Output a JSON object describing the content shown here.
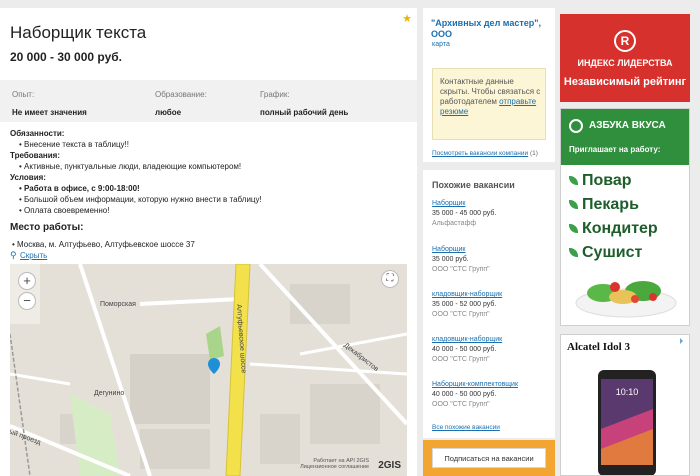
{
  "job": {
    "title": "Наборщик текста",
    "salary": "20 000 - 30 000 руб.",
    "starred": true
  },
  "meta": [
    {
      "label": "Опыт:",
      "value": "Не имеет значения"
    },
    {
      "label": "Образование:",
      "value": "любое"
    },
    {
      "label": "График:",
      "value": "полный рабочий день"
    }
  ],
  "description": {
    "duties_h": "Обязанности:",
    "duties": [
      "Внесение текста в таблицу!!"
    ],
    "reqs_h": "Требования:",
    "reqs": [
      "Активные, пунктуальные люди, владеющие компьютером!"
    ],
    "cond_h": "Условия:",
    "cond": [
      "Работа в офисе, с 9:00-18:00!",
      "Большой объем информации, которую нужно внести в таблицу!",
      "Оплата своевременно!"
    ]
  },
  "place": {
    "heading": "Место работы:",
    "address": "Москва, м. Алтуфьево, Алтуфьевское шоссе 37",
    "hide_link": "Скрыть"
  },
  "map": {
    "zoom_in": "+",
    "zoom_out": "−",
    "labels": {
      "pomorskaya": "Поморская",
      "degunino": "Дегунино",
      "altufevskoe": "Алтуфьевское шоссе",
      "dekabristov": "Декабристов",
      "proezd": "ый проезд"
    },
    "copyright_1": "Работает на API 2GIS",
    "copyright_2": "Лицензионное соглашение",
    "logo": "2GIS"
  },
  "company": {
    "name": "\"Архивных дел мастер\", ООО",
    "map_link": "карта",
    "hidden_text": "Контактные данные скрыты. Чтобы связаться с работодателем ",
    "hidden_link": "отправьте резюме",
    "vacancies_link": "Посмотреть вакансии компании",
    "vacancies_count": "(1)"
  },
  "similar": {
    "heading": "Похожие вакансии",
    "items": [
      {
        "title": "Наборщик",
        "salary": "35 000 - 45 000 руб.",
        "company": "Альфастафф"
      },
      {
        "title": "Наборщик",
        "salary": "35 000 руб.",
        "company": "ООО \"СТС Групп\""
      },
      {
        "title": "кладовщик-наборщик",
        "salary": "35 000 - 52 000 руб.",
        "company": "ООО \"СТС Групп\""
      },
      {
        "title": "кладовщик-наборщик",
        "salary": "40 000 - 50 000 руб.",
        "company": "ООО \"СТС Групп\""
      },
      {
        "title": "Наборщик-комплектовщик",
        "salary": "40 000 - 50 000 руб.",
        "company": "ООО \"СТС Групп\""
      }
    ],
    "all_link": "Все похожие вакансии",
    "subscribe": "Подписаться на вакансии"
  },
  "ads": {
    "ad1_logo": "R",
    "ad1_line1": "ИНДЕКС ЛИДЕРСТВА",
    "ad1_line2": "Независимый рейтинг",
    "ad2_brand": "АЗБУКА ВКУСА",
    "ad2_sub": "Приглашает на работу:",
    "ad2_items": [
      "Повар",
      "Пекарь",
      "Кондитер",
      "Сушист"
    ],
    "ad3_title": "Alcatel Idol 3",
    "ad3_time": "10:10"
  },
  "colors": {
    "link": "#1a6fb0",
    "ad_red": "#d7312d",
    "ad_green": "#2f8f3d",
    "subscribe_bg": "#f3a531",
    "map_pin": "#1f8fd8",
    "map_highway": "#f2e14a"
  }
}
